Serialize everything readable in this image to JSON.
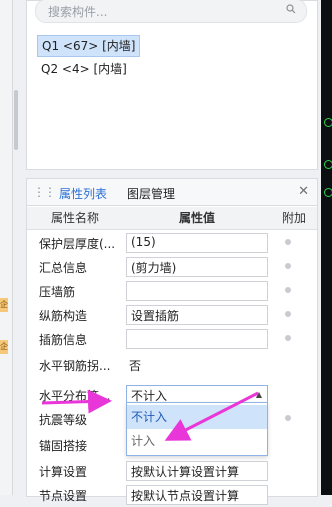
{
  "search": {
    "placeholder": "搜索构件..."
  },
  "components": [
    {
      "label": "Q1 <67> [内墙]",
      "selected": true
    },
    {
      "label": "Q2 <4> [内墙]",
      "selected": false
    }
  ],
  "tabs": [
    {
      "label": "属性列表",
      "active": true
    },
    {
      "label": "图层管理",
      "active": false
    }
  ],
  "table": {
    "headers": {
      "name": "属性名称",
      "value": "属性值",
      "extra": "附加"
    },
    "rows": [
      {
        "name": "保护层厚度(...",
        "value": "(15)"
      },
      {
        "name": "汇总信息",
        "value": "(剪力墙)"
      },
      {
        "name": "压墙筋",
        "value": ""
      },
      {
        "name": "纵筋构造",
        "value": "设置插筋"
      },
      {
        "name": "插筋信息",
        "value": ""
      },
      {
        "name": "水平钢筋拐...",
        "value": "否"
      },
      {
        "name": "水平分布筋...",
        "value": "不计入"
      },
      {
        "name": "抗震等级",
        "value": ""
      },
      {
        "name": "锚固搭接",
        "value": ""
      },
      {
        "name": "计算设置",
        "value": "按默认计算设置计算"
      },
      {
        "name": "节点设置",
        "value": "按默认节点设置计算"
      }
    ]
  },
  "dropdown": {
    "options": [
      "不计入",
      "计入"
    ]
  },
  "left_tabs": [
    "企",
    "企"
  ],
  "colors": {
    "accent": "#2a6fd6",
    "arrow": "#e936d8",
    "selection": "#cfe3fb"
  }
}
